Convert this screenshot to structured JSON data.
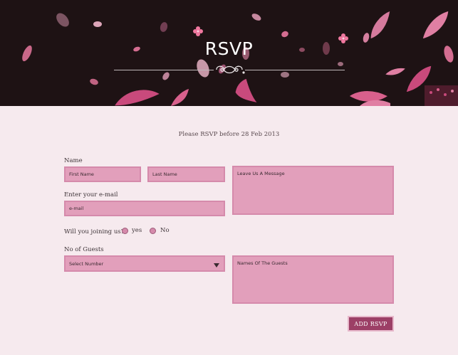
{
  "header": {
    "title": "RSVP",
    "colors": {
      "background": "#1e1214",
      "petal": "#e8789e",
      "leaf": "#d04d7d"
    }
  },
  "deadline_text": "Please RSVP before 28 Feb 2013",
  "form": {
    "name_label": "Name",
    "first_name_placeholder": "First Name",
    "last_name_placeholder": "Last Name",
    "message_placeholder": "Leave Us A Message",
    "email_label": "Enter your e-mail",
    "email_placeholder": "e-mail",
    "joining_label": "Will you joining us?",
    "joining_options": [
      "yes",
      "No"
    ],
    "guests_label": "No of Guests",
    "guests_select_value": "Select Number",
    "guest_names_placeholder": "Names Of The Guests",
    "submit_label": "ADD RSVP"
  },
  "colors": {
    "page_background": "#f6eaee",
    "field_background": "#e29fbb",
    "field_border": "#d58aab",
    "button_background": "#9c3f66"
  }
}
